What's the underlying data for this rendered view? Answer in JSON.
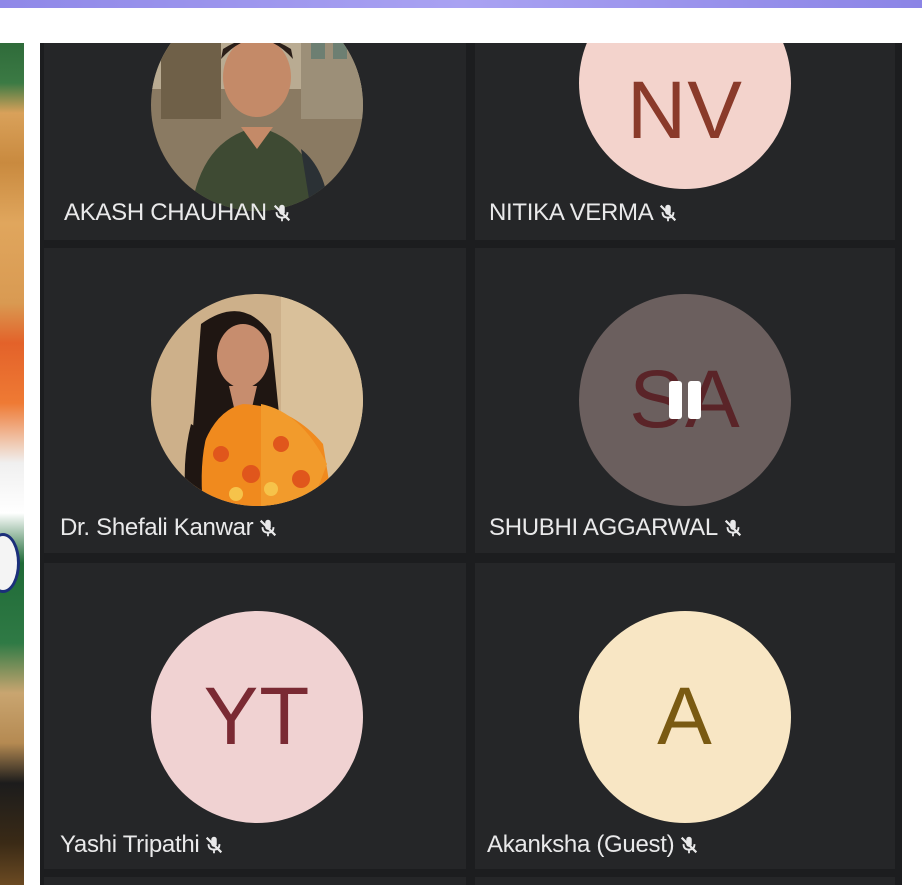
{
  "participants": [
    {
      "name": "AKASH CHAUHAN",
      "initials": "",
      "avatar_type": "photo",
      "avatar_bg": "#7a6a52",
      "initials_color": ""
    },
    {
      "name": "NITIKA VERMA",
      "initials": "NV",
      "avatar_type": "initials",
      "avatar_bg": "#f3d3cc",
      "initials_color": "#8a3a2a"
    },
    {
      "name": "Dr. Shefali Kanwar",
      "initials": "",
      "avatar_type": "photo",
      "avatar_bg": "#c9a77c",
      "initials_color": ""
    },
    {
      "name": "SHUBHI AGGARWAL",
      "initials": "SA",
      "avatar_type": "initials",
      "avatar_bg": "#6b5f5e",
      "initials_color": "#5a2428"
    },
    {
      "name": "Yashi Tripathi",
      "initials": "YT",
      "avatar_type": "initials",
      "avatar_bg": "#f0d2d2",
      "initials_color": "#7a2a33"
    },
    {
      "name": "Akanksha (Guest)",
      "initials": "A",
      "avatar_type": "initials",
      "avatar_bg": "#f8e6c4",
      "initials_color": "#7a5a12"
    }
  ],
  "muted_icon": "mic-off-icon",
  "pause_icon": "pause-icon",
  "theme": {
    "grid_bg": "#1c1d1f",
    "tile_bg": "#252628",
    "name_color": "#e9e9ea",
    "accent": "#9a93ee"
  }
}
